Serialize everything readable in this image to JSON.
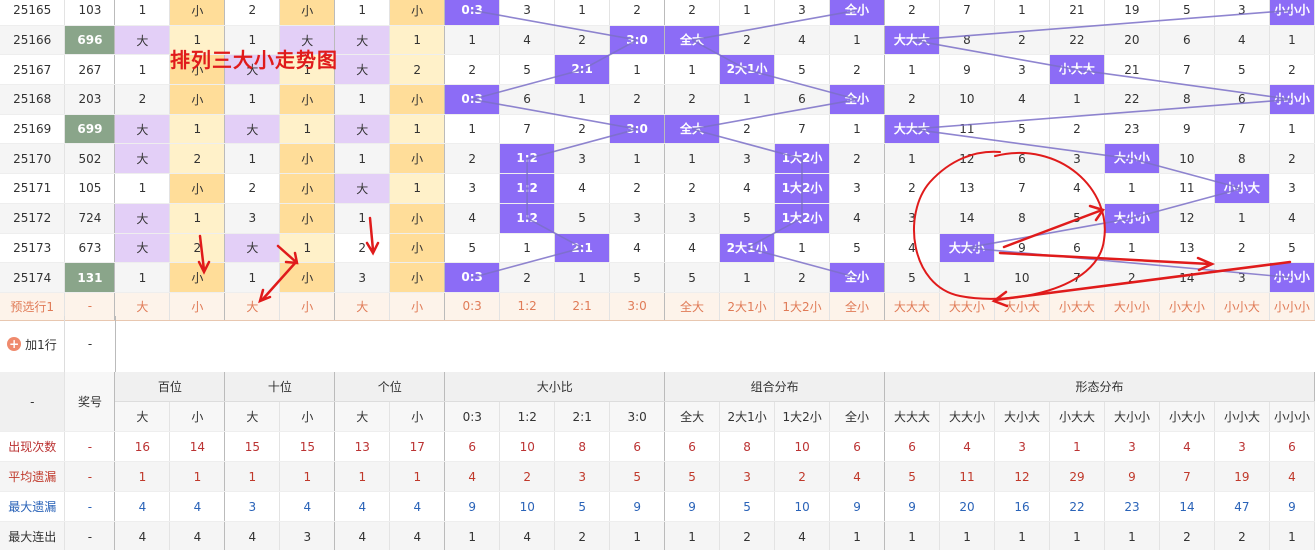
{
  "overlay_title": "排列三大小走势图",
  "rows": [
    {
      "issue": "25165",
      "code": "103",
      "bai": [
        "1",
        "小"
      ],
      "shi": [
        "2",
        "小"
      ],
      "ge": [
        "1",
        "小"
      ],
      "ratio": [
        "0:3",
        "3",
        "1",
        "2"
      ],
      "combo": [
        "2",
        "1",
        "3",
        "全小"
      ],
      "form": [
        "2",
        "7",
        "1",
        "21",
        "19",
        "5",
        "3",
        "小小小"
      ]
    },
    {
      "issue": "25166",
      "code": "696",
      "bai": [
        "大",
        "1"
      ],
      "shi": [
        "1",
        "大"
      ],
      "ge": [
        "大",
        "1"
      ],
      "ratio": [
        "1",
        "4",
        "2",
        "3:0"
      ],
      "combo": [
        "全大",
        "2",
        "4",
        "1"
      ],
      "form": [
        "大大大",
        "8",
        "2",
        "22",
        "20",
        "6",
        "4",
        "1"
      ]
    },
    {
      "issue": "25167",
      "code": "267",
      "bai": [
        "1",
        "小"
      ],
      "shi": [
        "大",
        "1"
      ],
      "ge": [
        "大",
        "2"
      ],
      "ratio": [
        "2",
        "5",
        "2:1",
        "1"
      ],
      "combo": [
        "1",
        "2大1小",
        "5",
        "2"
      ],
      "form": [
        "1",
        "9",
        "3",
        "小大大",
        "21",
        "7",
        "5",
        "2"
      ]
    },
    {
      "issue": "25168",
      "code": "203",
      "bai": [
        "2",
        "小"
      ],
      "shi": [
        "1",
        "小"
      ],
      "ge": [
        "1",
        "小"
      ],
      "ratio": [
        "0:3",
        "6",
        "1",
        "2"
      ],
      "combo": [
        "2",
        "1",
        "6",
        "全小"
      ],
      "form": [
        "2",
        "10",
        "4",
        "1",
        "22",
        "8",
        "6",
        "小小小"
      ]
    },
    {
      "issue": "25169",
      "code": "699",
      "bai": [
        "大",
        "1"
      ],
      "shi": [
        "大",
        "1"
      ],
      "ge": [
        "大",
        "1"
      ],
      "ratio": [
        "1",
        "7",
        "2",
        "3:0"
      ],
      "combo": [
        "全大",
        "2",
        "7",
        "1"
      ],
      "form": [
        "大大大",
        "11",
        "5",
        "2",
        "23",
        "9",
        "7",
        "1"
      ]
    },
    {
      "issue": "25170",
      "code": "502",
      "bai": [
        "大",
        "2"
      ],
      "shi": [
        "1",
        "小"
      ],
      "ge": [
        "1",
        "小"
      ],
      "ratio": [
        "2",
        "1:2",
        "3",
        "1"
      ],
      "combo": [
        "1",
        "3",
        "1大2小",
        "2"
      ],
      "form": [
        "1",
        "12",
        "6",
        "3",
        "大小小",
        "10",
        "8",
        "2"
      ]
    },
    {
      "issue": "25171",
      "code": "105",
      "bai": [
        "1",
        "小"
      ],
      "shi": [
        "2",
        "小"
      ],
      "ge": [
        "大",
        "1"
      ],
      "ratio": [
        "3",
        "1:2",
        "4",
        "2"
      ],
      "combo": [
        "2",
        "4",
        "1大2小",
        "3"
      ],
      "form": [
        "2",
        "13",
        "7",
        "4",
        "1",
        "11",
        "小小大",
        "3"
      ]
    },
    {
      "issue": "25172",
      "code": "724",
      "bai": [
        "大",
        "1"
      ],
      "shi": [
        "3",
        "小"
      ],
      "ge": [
        "1",
        "小"
      ],
      "ratio": [
        "4",
        "1:2",
        "5",
        "3"
      ],
      "combo": [
        "3",
        "5",
        "1大2小",
        "4"
      ],
      "form": [
        "3",
        "14",
        "8",
        "5",
        "大小小",
        "12",
        "1",
        "4"
      ]
    },
    {
      "issue": "25173",
      "code": "673",
      "bai": [
        "大",
        "2"
      ],
      "shi": [
        "大",
        "1"
      ],
      "ge": [
        "2",
        "小"
      ],
      "ratio": [
        "5",
        "1",
        "2:1",
        "4"
      ],
      "combo": [
        "4",
        "2大1小",
        "1",
        "5"
      ],
      "form": [
        "4",
        "大大小",
        "9",
        "6",
        "1",
        "13",
        "2",
        "5"
      ]
    },
    {
      "issue": "25174",
      "code": "131",
      "bai": [
        "1",
        "小"
      ],
      "shi": [
        "1",
        "小"
      ],
      "ge": [
        "3",
        "小"
      ],
      "ratio": [
        "0:3",
        "2",
        "1",
        "5"
      ],
      "combo": [
        "5",
        "1",
        "2",
        "全小"
      ],
      "form": [
        "5",
        "1",
        "10",
        "7",
        "2",
        "14",
        "3",
        "小小小"
      ]
    }
  ],
  "preselect": {
    "label": "预选行1",
    "dash": "-",
    "cells": [
      "大",
      "小",
      "大",
      "小",
      "大",
      "小",
      "0:3",
      "1:2",
      "2:1",
      "3:0",
      "全大",
      "2大1小",
      "1大2小",
      "全小",
      "大大大",
      "大大小",
      "大小大",
      "小大大",
      "大小小",
      "小大小",
      "小小大",
      "小小小"
    ]
  },
  "addrow": {
    "label": "加1行",
    "dash": "-"
  },
  "stats": {
    "corner": "-",
    "award_label": "奖号",
    "groups": [
      "百位",
      "十位",
      "个位",
      "大小比",
      "组合分布",
      "形态分布"
    ],
    "subs": [
      "大",
      "小",
      "大",
      "小",
      "大",
      "小",
      "0:3",
      "1:2",
      "2:1",
      "3:0",
      "全大",
      "2大1小",
      "1大2小",
      "全小",
      "大大大",
      "大大小",
      "大小大",
      "小大大",
      "大小小",
      "小大小",
      "小小大",
      "小小小"
    ],
    "rows": [
      {
        "label": "出现次数",
        "dash": "-",
        "vals": [
          "16",
          "14",
          "15",
          "15",
          "13",
          "17",
          "6",
          "10",
          "8",
          "6",
          "6",
          "8",
          "10",
          "6",
          "6",
          "4",
          "3",
          "1",
          "3",
          "4",
          "3",
          "6"
        ]
      },
      {
        "label": "平均遗漏",
        "dash": "-",
        "vals": [
          "1",
          "1",
          "1",
          "1",
          "1",
          "1",
          "4",
          "2",
          "3",
          "5",
          "5",
          "3",
          "2",
          "4",
          "5",
          "11",
          "12",
          "29",
          "9",
          "7",
          "19",
          "4"
        ]
      },
      {
        "label": "最大遗漏",
        "dash": "-",
        "vals": [
          "4",
          "4",
          "3",
          "4",
          "4",
          "4",
          "9",
          "10",
          "5",
          "9",
          "9",
          "5",
          "10",
          "9",
          "9",
          "20",
          "16",
          "22",
          "23",
          "14",
          "47",
          "9"
        ]
      },
      {
        "label": "最大连出",
        "dash": "-",
        "vals": [
          "4",
          "4",
          "4",
          "3",
          "4",
          "4",
          "1",
          "4",
          "2",
          "1",
          "1",
          "2",
          "4",
          "1",
          "1",
          "1",
          "1",
          "1",
          "1",
          "2",
          "2",
          "1"
        ]
      }
    ]
  },
  "colors": {
    "ball": "#8c6cf6",
    "purple_cell": "#e3cff7",
    "yellow_cell": "#ffdd99",
    "highlight_code": "#8aa58a",
    "annotation_red": "#e01b1b"
  }
}
